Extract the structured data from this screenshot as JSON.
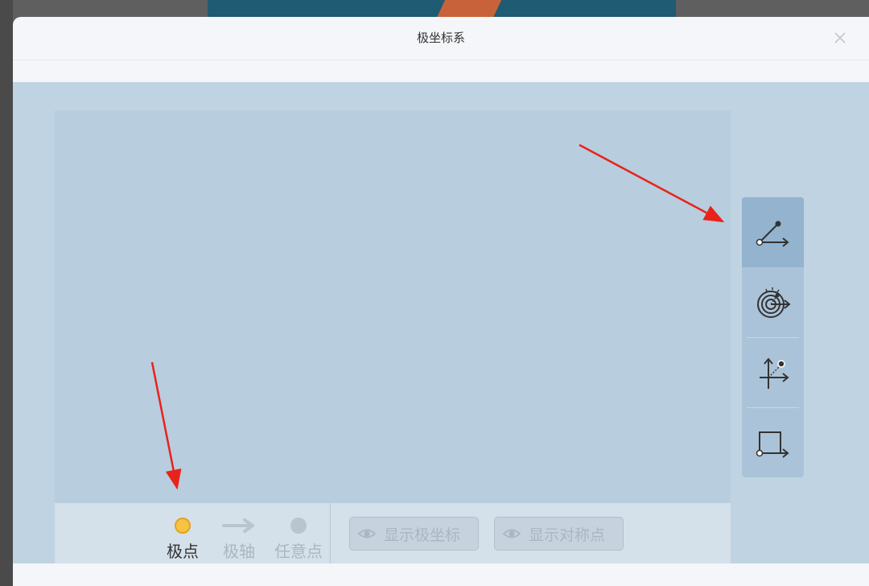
{
  "dialog": {
    "title": "极坐标系"
  },
  "legend": {
    "items": [
      {
        "label": "极点",
        "icon": "yellow-dot",
        "color": "#f6c343",
        "label_color": "#333333"
      },
      {
        "label": "极轴",
        "icon": "arrow-right",
        "color": "#b9c4cf",
        "label_color": "#aab6c1"
      },
      {
        "label": "任意点",
        "icon": "gray-dot",
        "color": "#b9c4cf",
        "label_color": "#aab6c1"
      }
    ]
  },
  "buttons": {
    "show_polar_coords": "显示极坐标",
    "show_symmetric_point": "显示对称点"
  },
  "toolbar": {
    "tools": [
      {
        "icon": "polar-angle-icon",
        "active": true
      },
      {
        "icon": "polar-grid-icon",
        "active": false
      },
      {
        "icon": "cartesian-point-icon",
        "active": false
      },
      {
        "icon": "rectangle-axis-icon",
        "active": false
      }
    ]
  },
  "colors": {
    "workspace": "#c0d3e2",
    "canvas": "#b8cddd",
    "toolbar": "#abc3d8",
    "toolbar_active": "#93b3cf",
    "annotation_arrow": "#e8231b"
  }
}
